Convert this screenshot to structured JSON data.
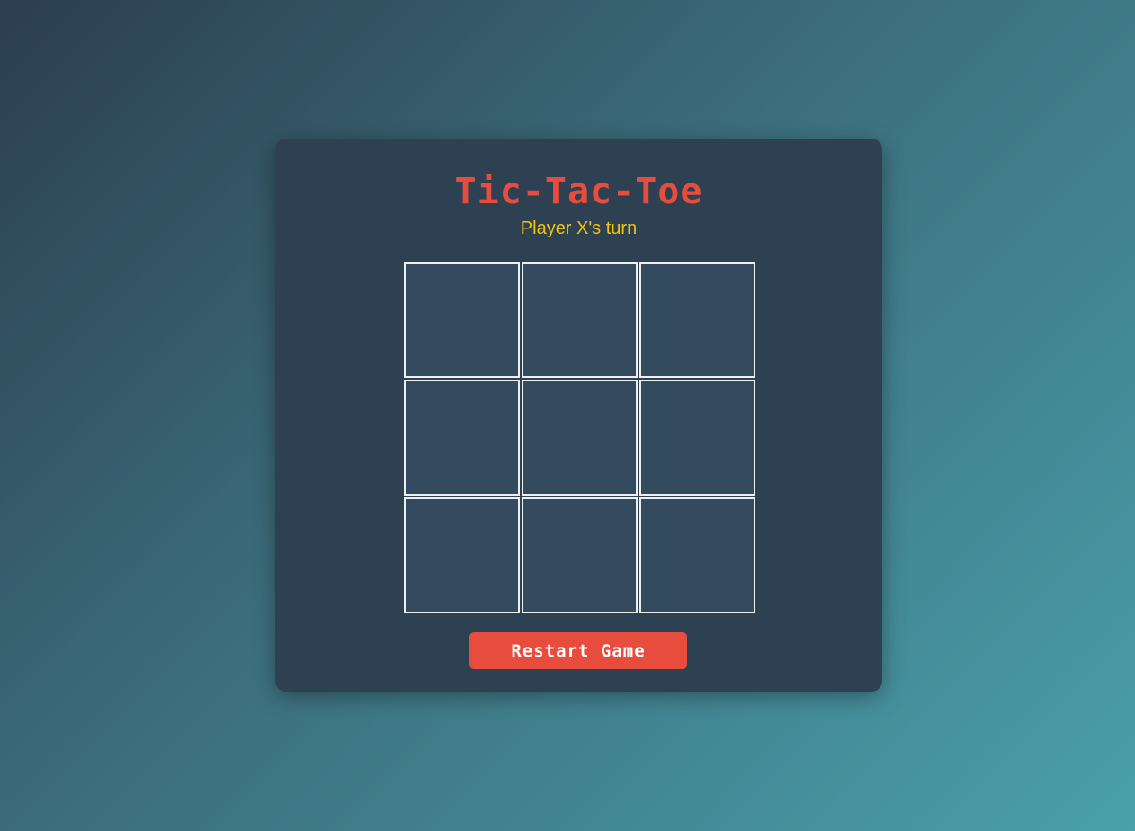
{
  "game": {
    "title": "Tic-Tac-Toe",
    "status": "Player X's turn",
    "board": [
      "",
      "",
      "",
      "",
      "",
      "",
      "",
      "",
      ""
    ],
    "restart_label": "Restart Game"
  },
  "colors": {
    "accent": "#e74c3c",
    "status": "#f1c40f",
    "panel": "#2e4153",
    "cell": "#344a5f",
    "cell_border": "#ecf0f1"
  }
}
